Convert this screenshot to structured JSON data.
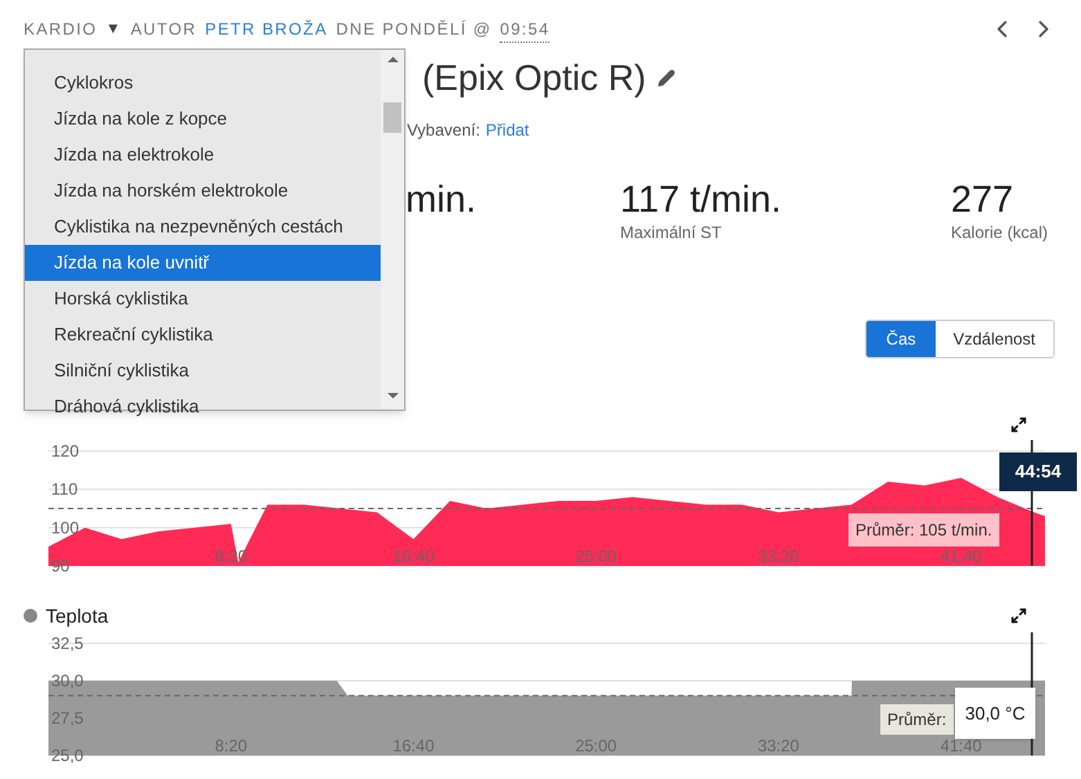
{
  "header": {
    "activity": "KARDIO",
    "caret": "▼",
    "author_prefix": "AUTOR",
    "author": "PETR BROŽA",
    "date_prefix": "DNE PONDĚLÍ @",
    "time": "09:54"
  },
  "activity_menu": {
    "items": [
      {
        "label": "Cyklokros",
        "selected": false
      },
      {
        "label": "Jízda na kole z kopce",
        "selected": false
      },
      {
        "label": "Jízda na elektrokole",
        "selected": false
      },
      {
        "label": "Jízda na horském elektrokole",
        "selected": false
      },
      {
        "label": "Cyklistika na nezpevněných cestách",
        "selected": false
      },
      {
        "label": "Jízda na kole uvnitř",
        "selected": true
      },
      {
        "label": "Horská cyklistika",
        "selected": false
      },
      {
        "label": "Rekreační cyklistika",
        "selected": false
      },
      {
        "label": "Silniční cyklistika",
        "selected": false
      },
      {
        "label": "Dráhová cyklistika",
        "selected": false
      }
    ]
  },
  "title": "(Epix Optic R)",
  "equipment": {
    "label": "Vybavení:",
    "link": "Přidat"
  },
  "stats": [
    {
      "value": "min."
    },
    {
      "value": "117 t/min.",
      "label": "Maximální ST"
    },
    {
      "value": "277",
      "label": "Kalorie (kcal)"
    }
  ],
  "axis_toggle": [
    {
      "label": "Čas",
      "selected": true
    },
    {
      "label": "Vzdálenost",
      "selected": false
    }
  ],
  "charts": [
    {
      "average_label": "Průměr: 105 t/min.",
      "cursor_label": "44:54",
      "chart_data": {
        "type": "area",
        "x": [
          0,
          100,
          200,
          300,
          400,
          500,
          520,
          600,
          700,
          800,
          900,
          1000,
          1100,
          1200,
          1300,
          1400,
          1500,
          1600,
          1700,
          1800,
          1900,
          2000,
          2100,
          2200,
          2300,
          2400,
          2500,
          2600,
          2700,
          2730
        ],
        "series": [
          {
            "color": "#ff2a55",
            "values": [
              95,
              100,
              97,
              99,
              100,
              101,
              91,
              106,
              106,
              105,
              104,
              97,
              107,
              105,
              106,
              107,
              107,
              108,
              107,
              106,
              106,
              104,
              105,
              106,
              112,
              111,
              113,
              108,
              104,
              103
            ]
          }
        ],
        "xlim": [
          0,
          2730
        ],
        "ylim": [
          90,
          120
        ],
        "xticks": [
          {
            "value": 500,
            "label": "8:20"
          },
          {
            "value": 1000,
            "label": "16:40"
          },
          {
            "value": 1500,
            "label": "25:00"
          },
          {
            "value": 2000,
            "label": "33:20"
          },
          {
            "value": 2500,
            "label": "41:40"
          }
        ],
        "yticks": [
          90,
          100,
          110,
          120
        ],
        "ref_lines": [
          {
            "axis": "y",
            "value": 105
          },
          {
            "axis": "x",
            "value": 2694
          }
        ]
      }
    },
    {
      "title": "Teplota",
      "color": "#888888",
      "average_label": "Průměr:",
      "cursor_label": "30,0 °C",
      "chart_data": {
        "type": "area",
        "x": [
          0,
          790,
          820,
          2200,
          2201,
          2730
        ],
        "series": [
          {
            "color": "#9a9a9a",
            "values": [
              30,
              30,
              29,
              29,
              30,
              30
            ]
          }
        ],
        "xlim": [
          0,
          2730
        ],
        "ylim": [
          25,
          32.5
        ],
        "xticks": [
          {
            "value": 500,
            "label": "8:20"
          },
          {
            "value": 1000,
            "label": "16:40"
          },
          {
            "value": 1500,
            "label": "25:00"
          },
          {
            "value": 2000,
            "label": "33:20"
          },
          {
            "value": 2500,
            "label": "41:40"
          }
        ],
        "yticks": [
          {
            "value": 25,
            "label": "25,0"
          },
          {
            "value": 27.5,
            "label": "27,5"
          },
          {
            "value": 30,
            "label": "30,0"
          },
          {
            "value": 32.5,
            "label": "32,5"
          }
        ],
        "ref_lines": [
          {
            "axis": "y",
            "value": 29
          },
          {
            "axis": "x",
            "value": 2694
          }
        ]
      }
    }
  ]
}
